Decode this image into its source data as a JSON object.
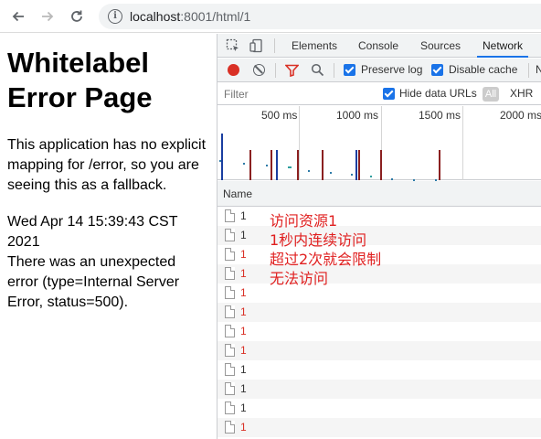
{
  "browser": {
    "url_host": "localhost",
    "url_rest": ":8001/html/1"
  },
  "page": {
    "title": "Whitelabel Error Page",
    "message": "This application has no explicit mapping for /error, so you are seeing this as a fallback.",
    "timestamp": "Wed Apr 14 15:39:43 CST 2021",
    "error": "There was an unexpected error (type=Internal Server Error, status=500)."
  },
  "devtools": {
    "tabs": [
      "Elements",
      "Console",
      "Sources",
      "Network"
    ],
    "active_tab": "Network",
    "toolbar": {
      "preserve_log": "Preserve log",
      "disable_cache": "Disable cache",
      "preserve_log_checked": true,
      "disable_cache_checked": true
    },
    "filter": {
      "placeholder": "Filter",
      "hide_data_urls": "Hide data URLs",
      "all": "All",
      "xhr": "XHR"
    },
    "timeline_labels": [
      "500 ms",
      "1000 ms",
      "1500 ms",
      "2000 ms"
    ],
    "name_header": "Name",
    "requests": [
      {
        "name": "1",
        "error": false
      },
      {
        "name": "1",
        "error": false
      },
      {
        "name": "1",
        "error": true
      },
      {
        "name": "1",
        "error": true
      },
      {
        "name": "1",
        "error": true
      },
      {
        "name": "1",
        "error": true
      },
      {
        "name": "1",
        "error": true
      },
      {
        "name": "1",
        "error": true
      },
      {
        "name": "1",
        "error": false
      },
      {
        "name": "1",
        "error": false
      },
      {
        "name": "1",
        "error": false
      },
      {
        "name": "1",
        "error": true
      },
      {
        "name": "1",
        "error": true
      }
    ],
    "annotation": [
      "访问资源1",
      "1秒内连续访问",
      "超过2次就会限制",
      "无法访问"
    ]
  },
  "colors": {
    "accent": "#1a73e8",
    "error": "#d93025",
    "annotation": "#e02020"
  }
}
